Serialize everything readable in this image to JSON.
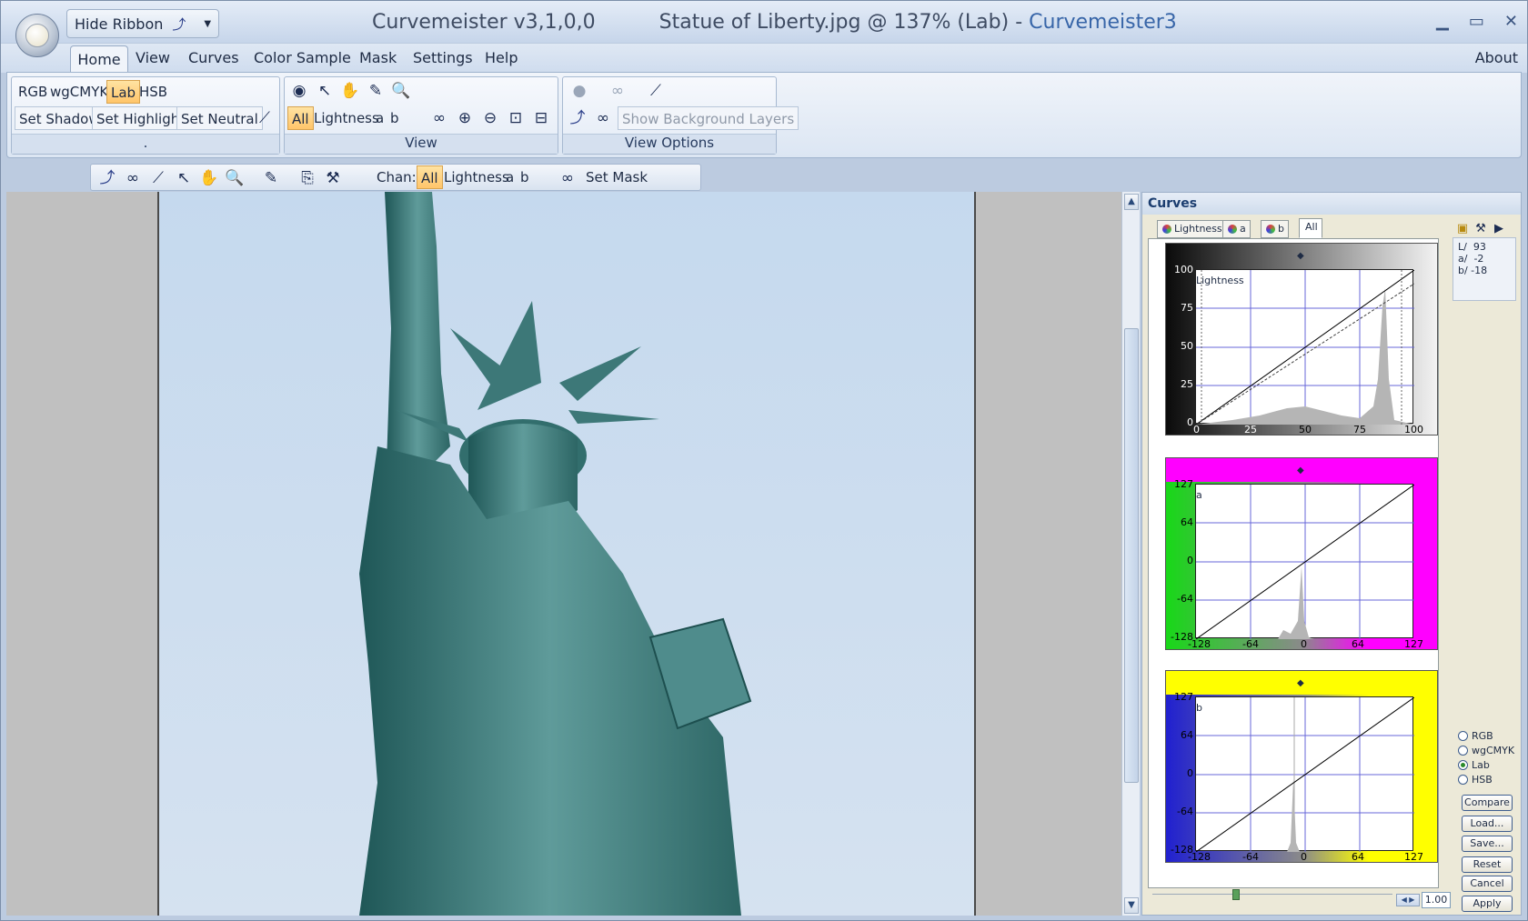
{
  "app": {
    "name": "Curvemeister v3,1,0,0",
    "document": "Statue of Liberty.jpg @ 137% (Lab) - ",
    "suffix": "Curvemeister3",
    "qat_label": "Hide Ribbon",
    "window_controls": [
      "minimize",
      "maximize",
      "close"
    ]
  },
  "menu": [
    "Home",
    "View",
    "Curves",
    "Color Sample",
    "Mask",
    "Settings",
    "Help"
  ],
  "about": "About",
  "ribbon": {
    "modes": [
      "RGB",
      "wgCMYK",
      "Lab",
      "HSB"
    ],
    "active_mode": "Lab",
    "set_buttons": [
      "Set Shadow",
      "Set Highlight",
      "Set Neutral"
    ],
    "group1_label": ".",
    "view_channels": [
      "All",
      "Lightness",
      "a",
      "b"
    ],
    "view_label": "View",
    "show_bg_layers": "Show Background Layers",
    "view_options_label": "View Options"
  },
  "toolbar": {
    "chan_label": "Chan:",
    "channels": [
      "All",
      "Lightness",
      "a",
      "b"
    ],
    "set_mask": "Set Mask"
  },
  "panel": {
    "title": "Curves",
    "tabs": [
      "Lightness",
      "a",
      "b",
      "All"
    ],
    "active_tab": "All",
    "readout": {
      "L": "L/  93",
      "a": "a/  -2",
      "b": "b/ -18"
    },
    "modes": [
      "RGB",
      "wgCMYK",
      "Lab",
      "HSB"
    ],
    "selected_mode": "Lab",
    "buttons": [
      "Compare",
      "Load...",
      "Save...",
      "Reset",
      "Cancel",
      "Apply"
    ],
    "zoom_value": "1.00"
  },
  "curves": {
    "lightness": {
      "name": "Lightness",
      "y_ticks": [
        "100",
        "75",
        "50",
        "25",
        "0"
      ],
      "x_ticks": [
        "0",
        "25",
        "50",
        "75",
        "100"
      ],
      "color": "#9a9a9a"
    },
    "a": {
      "name": "a",
      "y_ticks": [
        "127",
        "64",
        "0",
        "-64",
        "-128"
      ],
      "x_ticks": [
        "-128",
        "-64",
        "0",
        "64",
        "127"
      ],
      "color": "#ff00ff"
    },
    "b": {
      "name": "b",
      "y_ticks": [
        "127",
        "64",
        "0",
        "-64",
        "-128"
      ],
      "x_ticks": [
        "-128",
        "-64",
        "0",
        "64",
        "127"
      ],
      "color": "#ffff00"
    }
  }
}
